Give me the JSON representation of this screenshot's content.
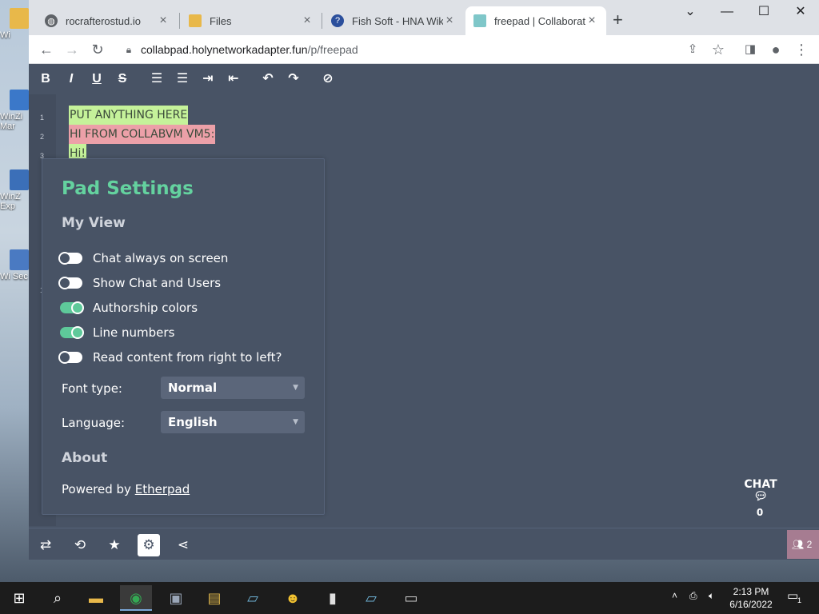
{
  "desktop": {
    "icons": [
      {
        "label": "Wi",
        "color": "#e8b84a"
      },
      {
        "label": "WinZi Mar",
        "color": "#3b78c9"
      },
      {
        "label": "WinZ Exp",
        "color": "#3b6fb8"
      },
      {
        "label": "Wi Sec",
        "color": "#4a7ac2"
      }
    ]
  },
  "browser": {
    "tabs": [
      {
        "title": "rocrafterostud.io",
        "icon": "globe-icon",
        "close": "×"
      },
      {
        "title": "Files",
        "icon": "folder-icon",
        "close": "×"
      },
      {
        "title": "Fish Soft - HNA Wiki",
        "icon": "help-icon",
        "close": "×"
      },
      {
        "title": "freepad | Collaborativ",
        "icon": "pad-icon",
        "close": "×"
      }
    ],
    "new_tab": "+",
    "window_controls": {
      "dropdown": "⌄",
      "minimize": "—",
      "maximize": "☐",
      "close": "✕"
    },
    "toolbar": {
      "back": "←",
      "forward": "→",
      "reload": "↻",
      "url_host": "collabpad.holynetworkadapter.fun",
      "url_path": "/p/freepad"
    }
  },
  "pad": {
    "format_buttons": [
      {
        "name": "bold-icon",
        "glyph": "B"
      },
      {
        "name": "italic-icon",
        "glyph": "I"
      },
      {
        "name": "underline-icon",
        "glyph": "U"
      },
      {
        "name": "strikethrough-icon",
        "glyph": "S"
      },
      {
        "name": "ordered-list-icon",
        "glyph": "☰"
      },
      {
        "name": "unordered-list-icon",
        "glyph": "☰"
      },
      {
        "name": "indent-icon",
        "glyph": "⇥"
      },
      {
        "name": "outdent-icon",
        "glyph": "⇤"
      },
      {
        "name": "undo-icon",
        "glyph": "↶"
      },
      {
        "name": "redo-icon",
        "glyph": "↷"
      },
      {
        "name": "clear-authorship-icon",
        "glyph": "⊘"
      }
    ],
    "lines": [
      {
        "num": "1",
        "text": "PUT ANYTHING HERE",
        "color": "#c5f29a"
      },
      {
        "num": "2",
        "text": "HI FROM COLLABVM VM5:",
        "color": "#eca0a8"
      },
      {
        "num": "3",
        "text": "Hi!",
        "color": "#c5f29a"
      }
    ],
    "hidden_line_num": "1",
    "settings": {
      "title": "Pad Settings",
      "my_view": "My View",
      "toggles": [
        {
          "label": "Chat always on screen",
          "on": false
        },
        {
          "label": "Show Chat and Users",
          "on": false
        },
        {
          "label": "Authorship colors",
          "on": true
        },
        {
          "label": "Line numbers",
          "on": true
        },
        {
          "label": "Read content from right to left?",
          "on": false
        }
      ],
      "font_type_label": "Font type:",
      "font_type_value": "Normal",
      "language_label": "Language:",
      "language_value": "English",
      "about": "About",
      "powered_by": "Powered by ",
      "powered_link": "Etherpad"
    },
    "chat": {
      "label": "CHAT",
      "icon": "chat-icon",
      "count": "0"
    },
    "bottom_buttons": [
      {
        "name": "import-export-icon",
        "glyph": "⇄"
      },
      {
        "name": "timeslider-icon",
        "glyph": "⟲"
      },
      {
        "name": "star-icon",
        "glyph": "★"
      },
      {
        "name": "settings-icon",
        "glyph": "⚙"
      },
      {
        "name": "share-icon",
        "glyph": "⋖"
      }
    ],
    "users_count": "2"
  },
  "taskbar": {
    "start": "⊞",
    "search": "⌕",
    "apps": [
      {
        "name": "file-explorer-icon",
        "glyph": "▬",
        "color": "#e8b84a"
      },
      {
        "name": "chrome-icon",
        "glyph": "◉",
        "color": "#34a853"
      },
      {
        "name": "winzip-icon",
        "glyph": "▣",
        "color": "#9aa6b8"
      },
      {
        "name": "archive-icon",
        "glyph": "▤",
        "color": "#d9b24a"
      },
      {
        "name": "notes-icon",
        "glyph": "▱",
        "color": "#6fb5d8"
      },
      {
        "name": "face-app-icon",
        "glyph": "☻",
        "color": "#f2c230"
      },
      {
        "name": "document-icon",
        "glyph": "▮",
        "color": "#e0e0e0"
      },
      {
        "name": "notes2-icon",
        "glyph": "▱",
        "color": "#6fb5d8"
      },
      {
        "name": "terminal-icon",
        "glyph": "▭",
        "color": "#cfcfcf"
      }
    ],
    "time": "2:13 PM",
    "date": "6/16/2022",
    "notification_count": "1"
  }
}
